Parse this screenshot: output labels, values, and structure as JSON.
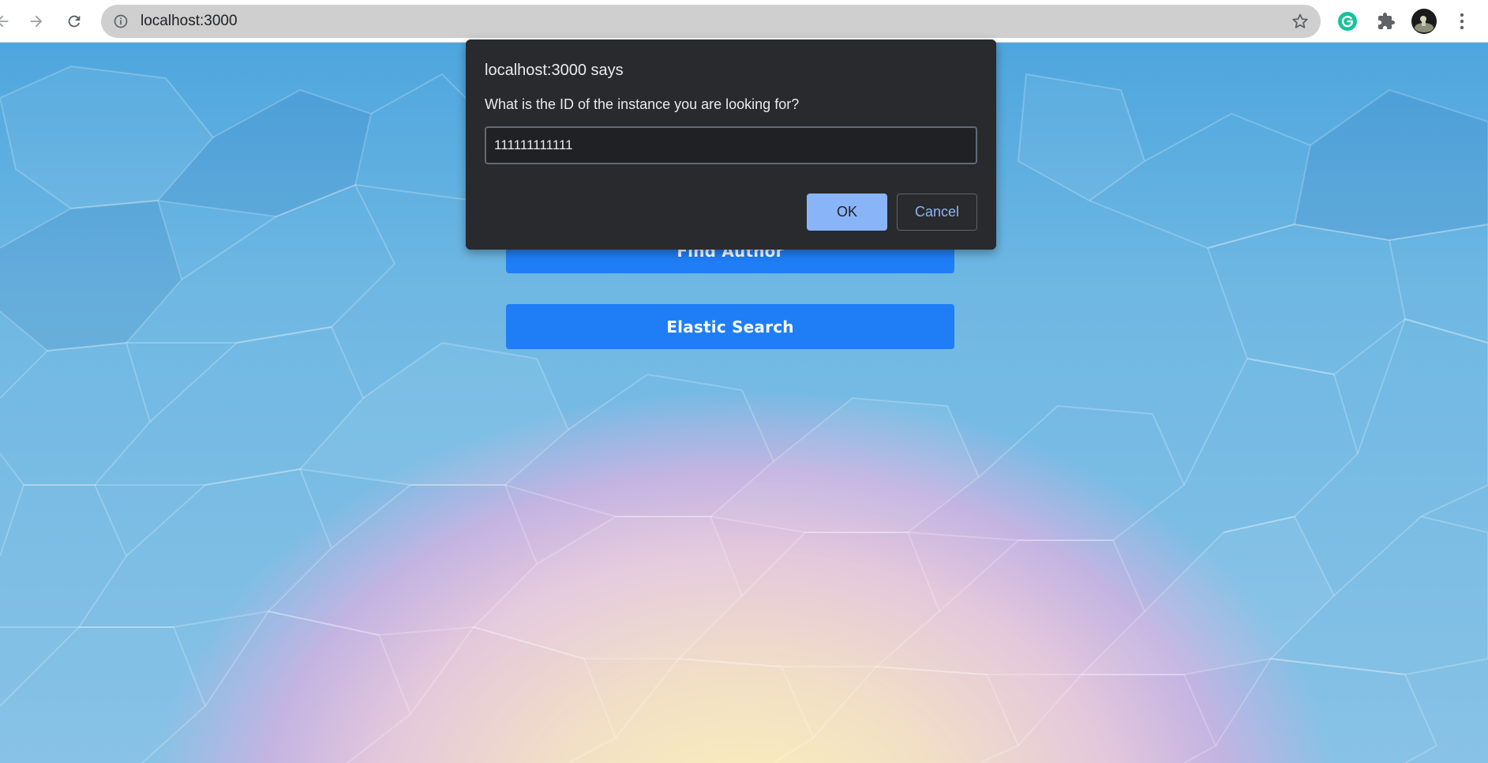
{
  "browser": {
    "url": "localhost:3000",
    "icons": {
      "back": "arrow-left-icon",
      "forward": "arrow-right-icon",
      "reload": "reload-icon",
      "site_info": "info-icon",
      "bookmark": "star-icon",
      "grammarly": "grammarly-icon",
      "extensions": "puzzle-icon",
      "profile": "avatar",
      "menu": "kebab-menu-icon"
    }
  },
  "page": {
    "buttons": [
      {
        "label": "Find Author"
      },
      {
        "label": "Elastic Search"
      }
    ],
    "colors": {
      "button_bg": "#1f7ef6",
      "button_text": "#ffffff"
    }
  },
  "dialog": {
    "title": "localhost:3000 says",
    "message": "What is the ID of the instance you are looking for?",
    "input_value": "111111111111",
    "ok_label": "OK",
    "cancel_label": "Cancel",
    "colors": {
      "background": "#292a2d",
      "ok_bg": "#8ab4f8",
      "cancel_text": "#8ab4f8"
    }
  }
}
